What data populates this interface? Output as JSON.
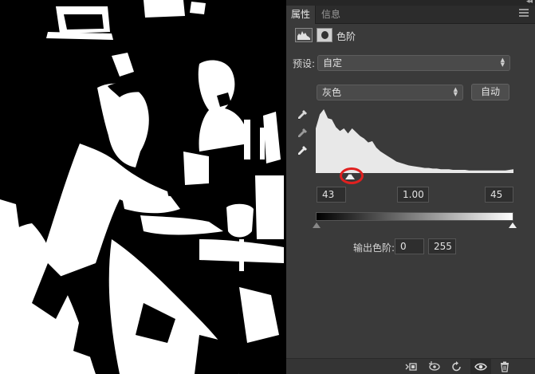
{
  "panel": {
    "tabs": [
      {
        "label": "属性",
        "active": true
      },
      {
        "label": "信息",
        "active": false
      }
    ],
    "adjustment_title": "色阶",
    "preset_label": "预设:",
    "preset_value": "自定",
    "channel_value": "灰色",
    "auto_label": "自动",
    "input_levels": {
      "black": "43",
      "gamma": "1.00",
      "white": "45"
    },
    "output_label": "输出色阶:",
    "output_levels": {
      "min": "0",
      "max": "255"
    },
    "icons": {
      "panel_menu": "hamburger-menu-icon",
      "collapse": "double-chevron-right-icon",
      "levels": "levels-histogram-icon",
      "mask": "layer-mask-icon",
      "eyedroppers": [
        "black-eyedropper-icon",
        "gray-eyedropper-icon",
        "white-eyedropper-icon"
      ],
      "footer": [
        "clip-to-layer-icon",
        "view-previous-state-icon",
        "reset-icon",
        "visibility-eye-icon",
        "trash-icon"
      ]
    },
    "colors": {
      "panel_bg": "#3a3a3a",
      "tab_bar_bg": "#2c2c2c",
      "highlight_ring": "#e0201f",
      "histogram_fill": "#e8e8e8"
    }
  },
  "histogram": {
    "profile": [
      70,
      92,
      100,
      86,
      84,
      72,
      66,
      70,
      62,
      70,
      64,
      58,
      54,
      48,
      50,
      40,
      34,
      30,
      26,
      22,
      18,
      16,
      14,
      12,
      11,
      10,
      9,
      8,
      8,
      7,
      7,
      6,
      6,
      6,
      5,
      5,
      5,
      5,
      4,
      4,
      4,
      4,
      4,
      4,
      4,
      4,
      4,
      4,
      5,
      6
    ],
    "input_black_level": 43,
    "input_white_level": 45,
    "gamma": 1.0,
    "output_min": 0,
    "output_max": 255
  }
}
